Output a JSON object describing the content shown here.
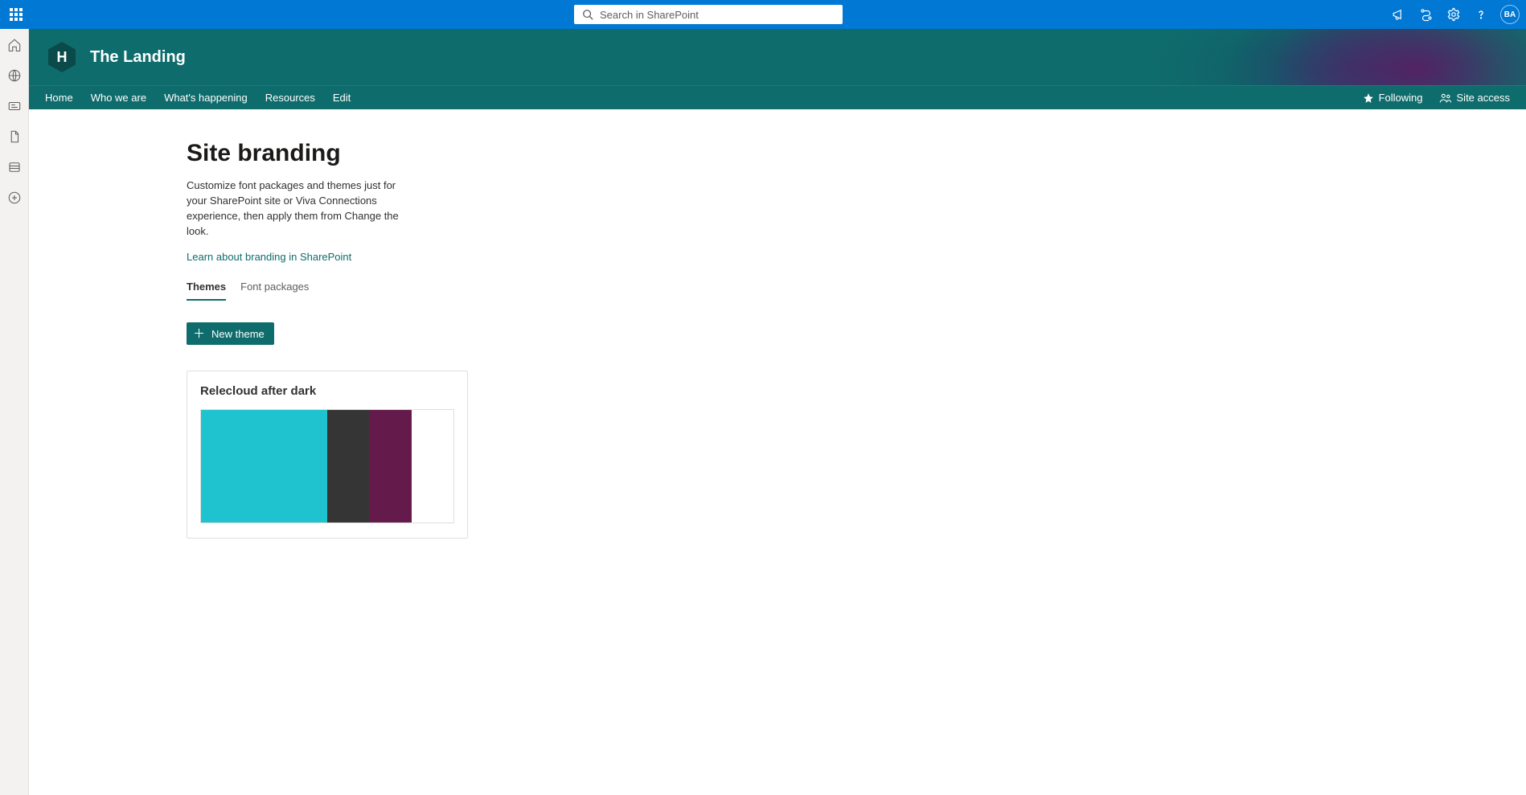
{
  "search": {
    "placeholder": "Search in SharePoint"
  },
  "avatar": {
    "initials": "BA"
  },
  "site": {
    "logo_letter": "H",
    "title": "The Landing"
  },
  "nav": {
    "home": "Home",
    "who": "Who we are",
    "happening": "What's happening",
    "resources": "Resources",
    "edit": "Edit",
    "following": "Following",
    "site_access": "Site access"
  },
  "page": {
    "title": "Site branding",
    "description": "Customize font packages and themes just for your SharePoint site or Viva Connections experience, then apply them from Change the look.",
    "learn_link": "Learn about branding in SharePoint"
  },
  "tabs": {
    "themes": "Themes",
    "fonts": "Font packages"
  },
  "new_button": "New theme",
  "theme": {
    "name": "Relecloud after dark",
    "colors": {
      "c1": "#1fc3cf",
      "c2": "#353535",
      "c3": "#641a4a",
      "c4": "#ffffff"
    }
  }
}
